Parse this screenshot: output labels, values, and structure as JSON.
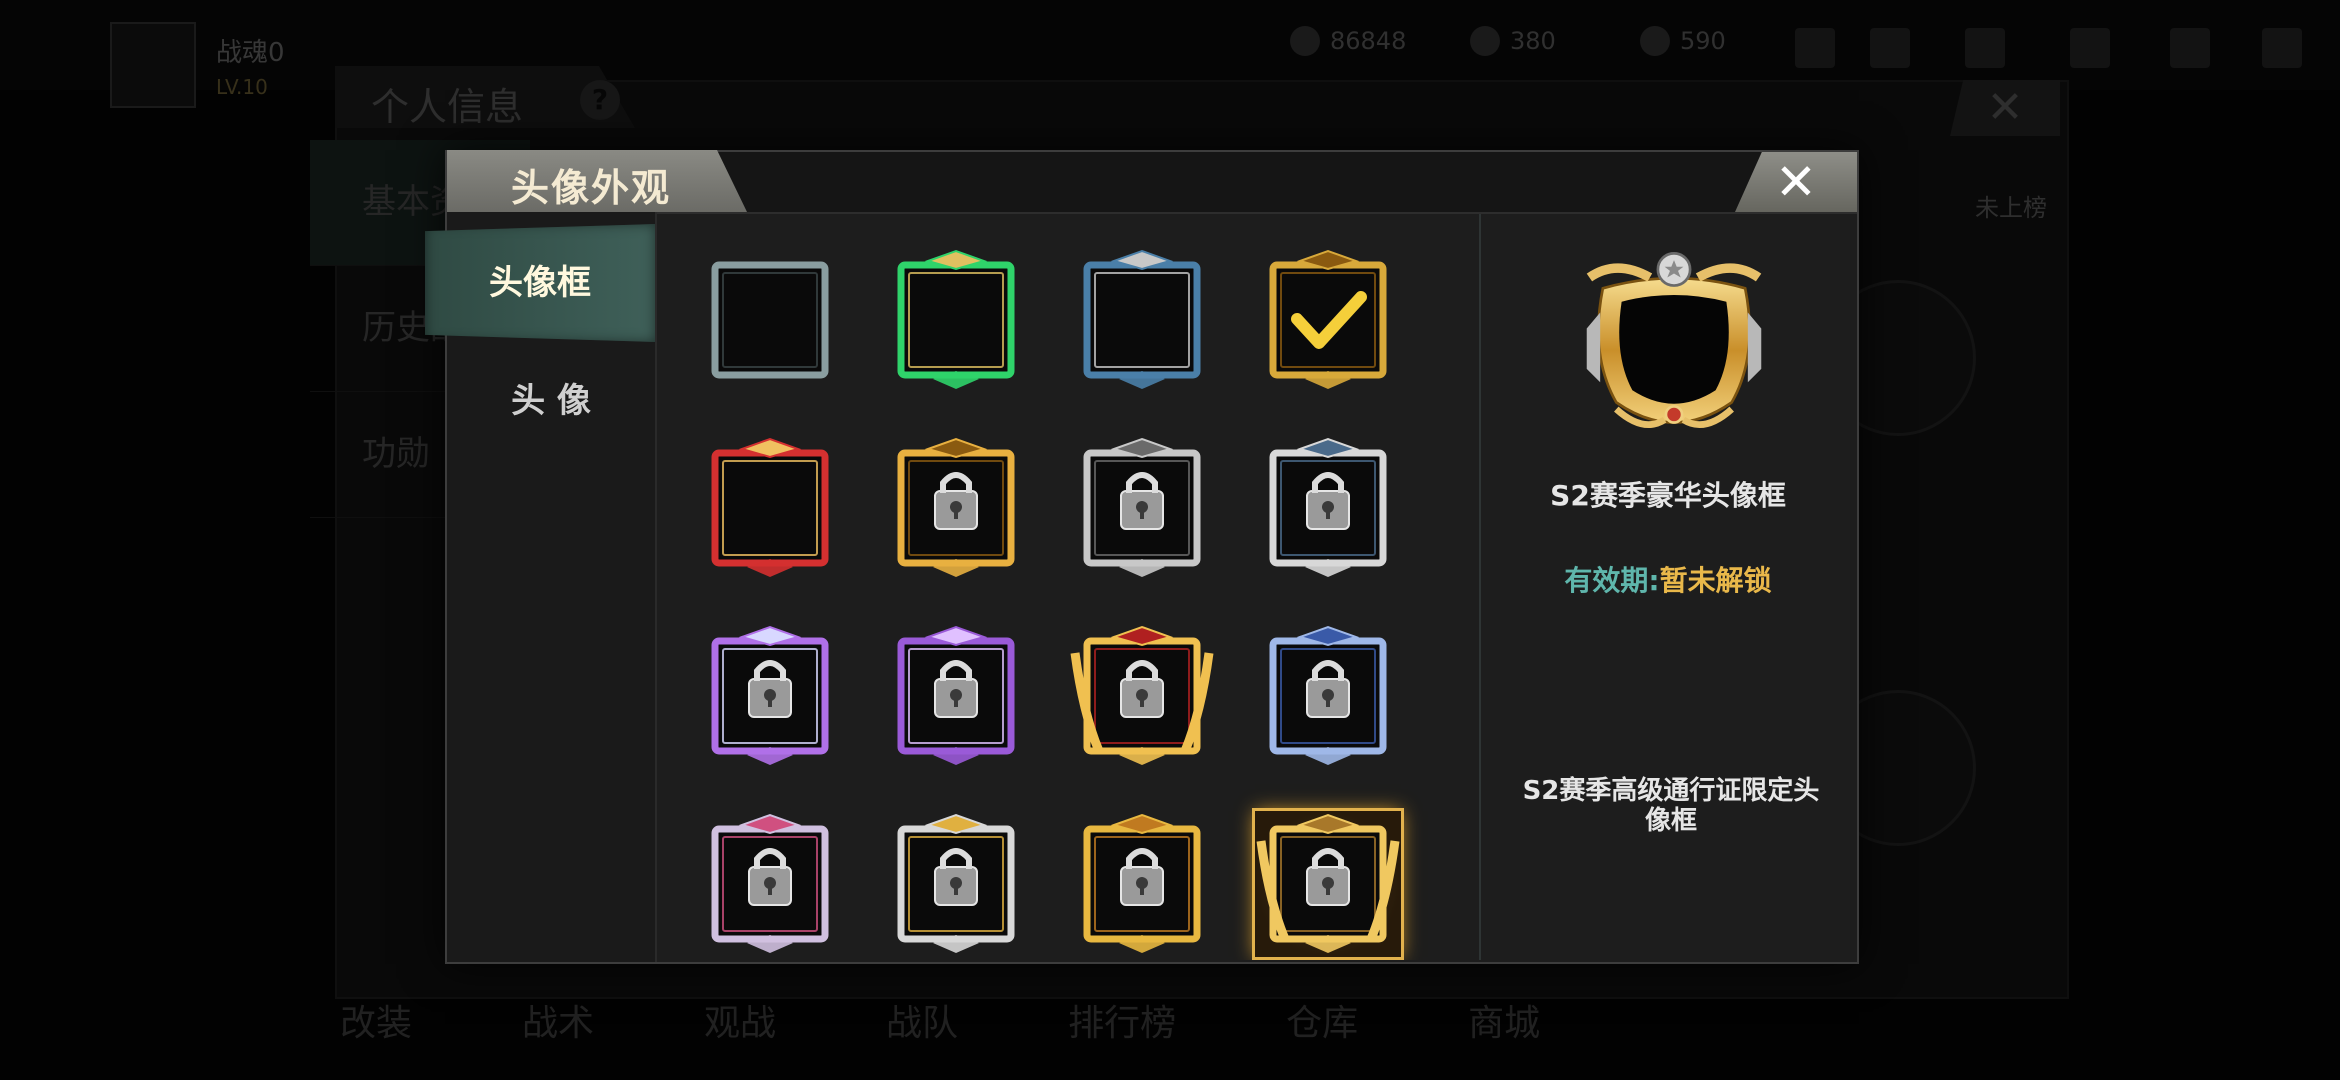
{
  "background": {
    "player_name": "战魂0",
    "player_level": "LV.10",
    "resources": [
      "86848",
      "380",
      "590"
    ],
    "panel_title": "个人信息",
    "help_icon": "?",
    "close_icon": "✕",
    "side_tabs": [
      "基本资料",
      "历史战绩",
      "功勋"
    ],
    "rank_status": "未上榜",
    "bottom_nav": [
      "改装",
      "战术",
      "观战",
      "战队",
      "排行榜",
      "仓库",
      "商城"
    ]
  },
  "dialog": {
    "title": "头像外观",
    "close_icon": "✕",
    "tabs": [
      {
        "label": "头像框",
        "active": true
      },
      {
        "label": "头 像",
        "active": false
      }
    ],
    "frames": [
      {
        "style": "plain",
        "locked": false,
        "selected": false
      },
      {
        "style": "green",
        "locked": false,
        "selected": false
      },
      {
        "style": "blue-mech",
        "locked": false,
        "selected": false
      },
      {
        "style": "gold-check",
        "locked": false,
        "selected": false
      },
      {
        "style": "red-gold",
        "locked": false,
        "selected": false
      },
      {
        "style": "gold",
        "locked": true,
        "selected": false
      },
      {
        "style": "silver",
        "locked": true,
        "selected": false
      },
      {
        "style": "silver-apple",
        "locked": true,
        "selected": false
      },
      {
        "style": "purple",
        "locked": true,
        "selected": false
      },
      {
        "style": "purple-ornate",
        "locked": true,
        "selected": false
      },
      {
        "style": "gold-wings",
        "locked": true,
        "selected": false
      },
      {
        "style": "ice-blue",
        "locked": true,
        "selected": false
      },
      {
        "style": "silver-pink",
        "locked": true,
        "selected": false
      },
      {
        "style": "silver-star",
        "locked": true,
        "selected": false
      },
      {
        "style": "gold-star",
        "locked": true,
        "selected": false
      },
      {
        "style": "gold-laurel",
        "locked": true,
        "selected": true
      }
    ],
    "detail": {
      "frame_name": "S2赛季豪华头像框",
      "validity_label": "有效期:",
      "validity_value": "暂未解锁",
      "description": "S2赛季高级通行证限定头像框"
    }
  },
  "colors": {
    "accent_gold": "#e9b84a",
    "accent_teal": "#5fb6ac",
    "tab_active": "#3f6059"
  }
}
